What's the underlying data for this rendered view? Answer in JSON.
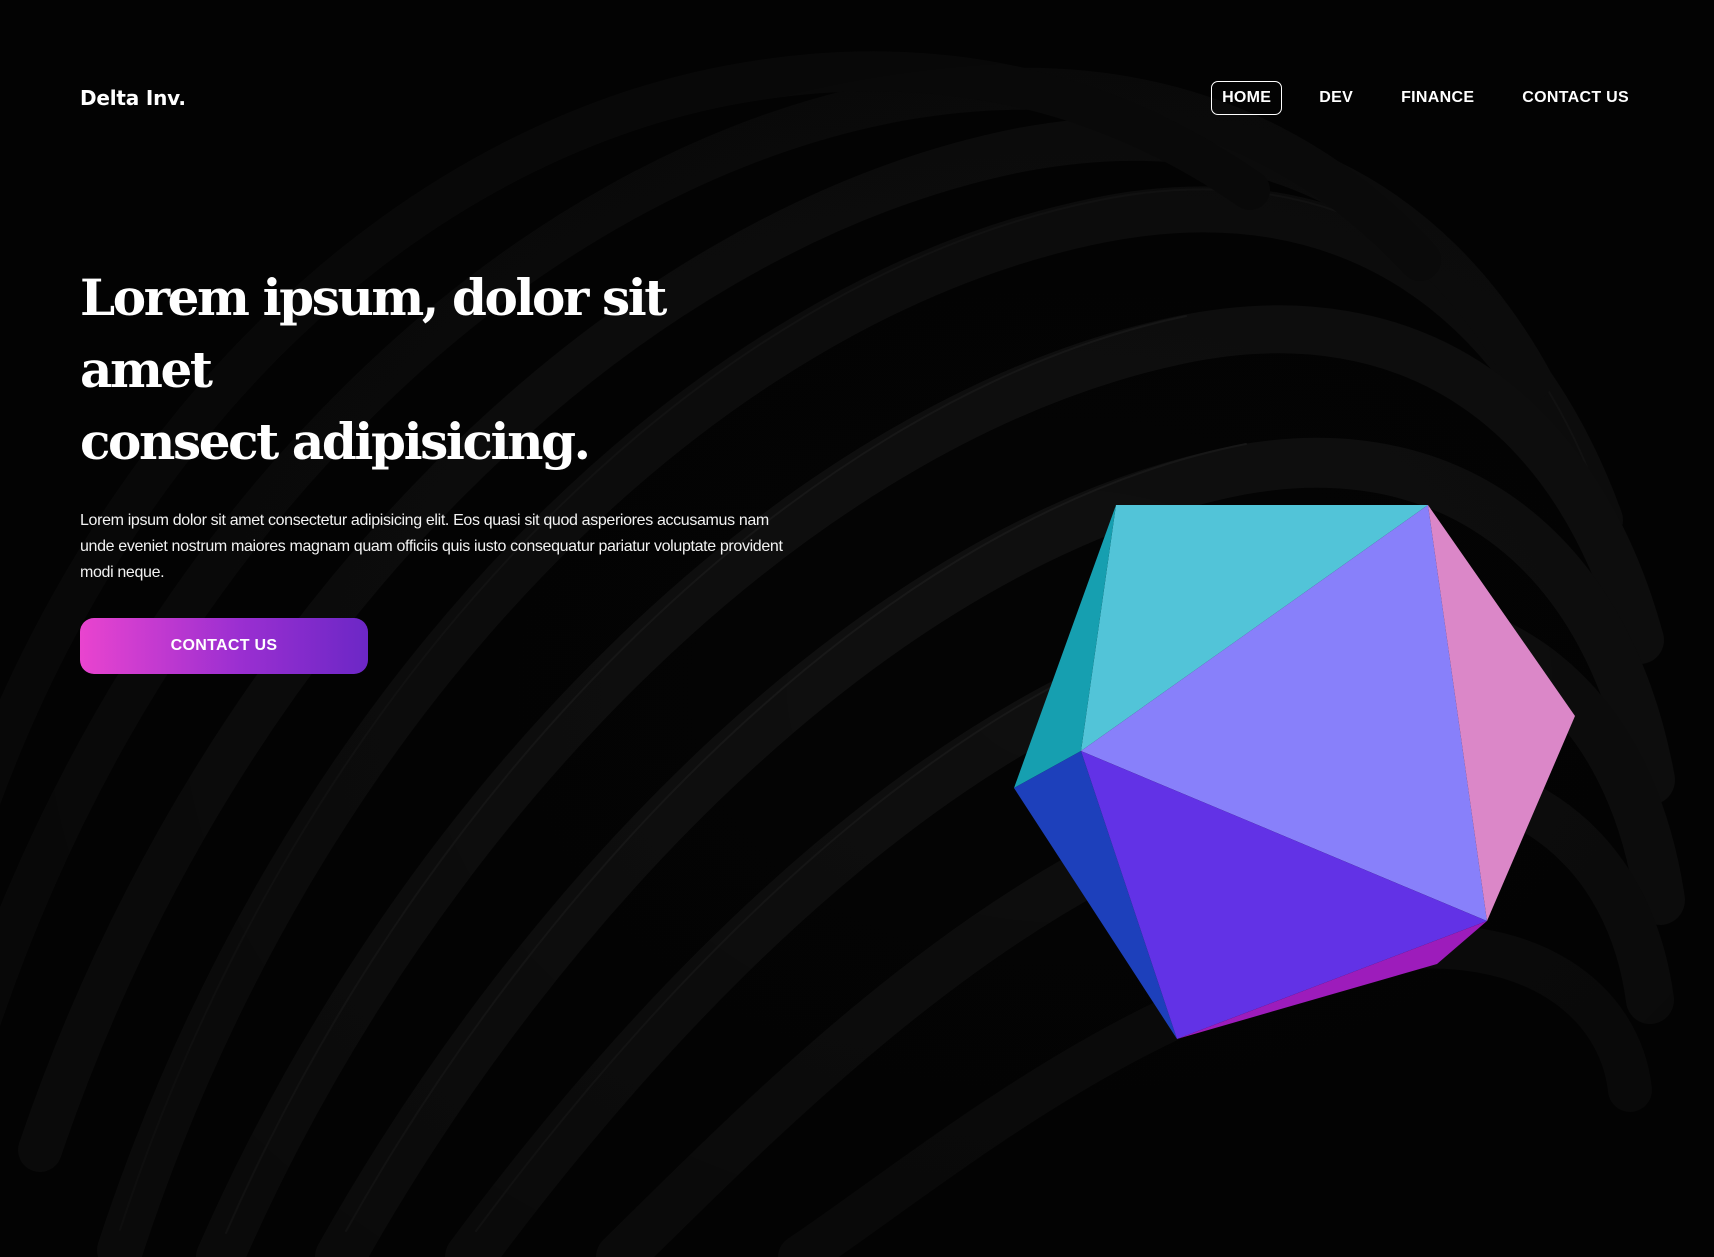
{
  "brand": {
    "name": "Delta Inv."
  },
  "nav": {
    "items": [
      {
        "label": "HOME",
        "active": true
      },
      {
        "label": "DEV",
        "active": false
      },
      {
        "label": "FINANCE",
        "active": false
      },
      {
        "label": "CONTACT US",
        "active": false
      }
    ]
  },
  "hero": {
    "title_line1": "Lorem ipsum, dolor sit amet",
    "title_line2": "consect adipisicing.",
    "description": "Lorem ipsum dolor sit amet consectetur adipisicing elit. Eos quasi sit quod asperiores accusamus nam unde eveniet nostrum maiores magnam quam officiis quis iusto consequatur pariatur voluptate provident modi neque.",
    "cta_label": "CONTACT US"
  },
  "colors": {
    "background": "#040404",
    "cta_gradient_start": "#e944cf",
    "cta_gradient_end": "#6c27c6",
    "gem_cyan": "#52c4d8",
    "gem_teal": "#169fb0",
    "gem_lavender": "#8880fa",
    "gem_pink": "#db87c8",
    "gem_blue": "#1d40bb",
    "gem_violet": "#6232e6",
    "gem_magenta": "#9d1cbb"
  },
  "icons": {
    "gem_graphic": "icosahedron-icon"
  }
}
